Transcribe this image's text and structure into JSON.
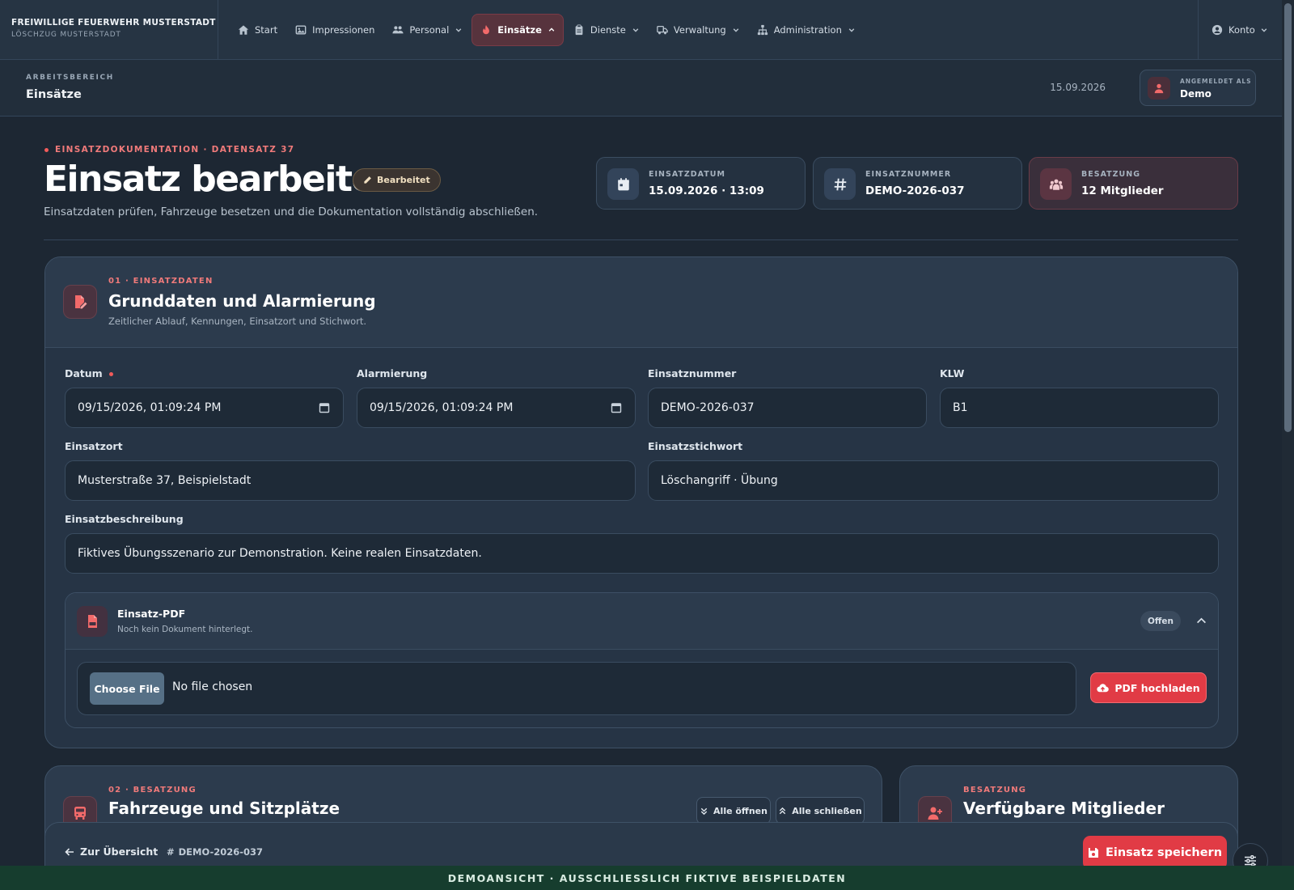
{
  "brand": {
    "name": "FREIWILLIGE FEUERWEHR MUSTERSTADT",
    "unit": "LÖSCHZUG MUSTERSTADT"
  },
  "nav": {
    "items": [
      {
        "label": "Start",
        "icon": "home-icon"
      },
      {
        "label": "Impressionen",
        "icon": "image-icon"
      },
      {
        "label": "Personal",
        "icon": "users-icon",
        "dropdown": true
      },
      {
        "label": "Einsätze",
        "icon": "flame-icon",
        "dropdown": true,
        "active": true
      },
      {
        "label": "Dienste",
        "icon": "clipboard-icon",
        "dropdown": true
      },
      {
        "label": "Verwaltung",
        "icon": "truck-icon",
        "dropdown": true
      },
      {
        "label": "Administration",
        "icon": "sitemap-icon",
        "dropdown": true
      }
    ],
    "account": {
      "label": "Konto",
      "icon": "user-circle-icon"
    }
  },
  "workspace": {
    "label": "ARBEITSBEREICH",
    "title": "Einsätze",
    "date": "15.09.2026",
    "user_label": "ANGEMELDET ALS",
    "user_name": "Demo"
  },
  "header": {
    "eyebrow": "EINSATZDOKUMENTATION · DATENSATZ 37",
    "title": "Einsatz bearbeiten",
    "badge": "Bearbeitet",
    "subtitle": "Einsatzdaten prüfen, Fahrzeuge besetzen und die Dokumentation vollständig abschließen.",
    "stats": [
      {
        "label": "EINSATZDATUM",
        "value": "15.09.2026 · 13:09",
        "icon": "calendar-icon"
      },
      {
        "label": "EINSATZNUMMER",
        "value": "DEMO-2026-037",
        "icon": "hash-icon"
      },
      {
        "label": "BESATZUNG",
        "value": "12 Mitglieder",
        "icon": "people-group-icon"
      }
    ]
  },
  "section1": {
    "eyebrow": "01 · EINSATZDATEN",
    "title": "Grunddaten und Alarmierung",
    "description": "Zeitlicher Ablauf, Kennungen, Einsatzort und Stichwort.",
    "fields": {
      "datum": {
        "label": "Datum",
        "value": "09/15/2026, 01:09:24 PM"
      },
      "alarmierung": {
        "label": "Alarmierung",
        "value": "09/15/2026, 01:09:24 PM"
      },
      "einsatznummer": {
        "label": "Einsatznummer",
        "value": "DEMO-2026-037"
      },
      "klw": {
        "label": "KLW",
        "value": "B1"
      },
      "einsatzort": {
        "label": "Einsatzort",
        "value": "Musterstraße 37, Beispielstadt"
      },
      "stichwort": {
        "label": "Einsatzstichwort",
        "value": "Löschangriff · Übung"
      },
      "beschreibung": {
        "label": "Einsatzbeschreibung",
        "value": "Fiktives Übungsszenario zur Demonstration. Keine realen Einsatzdaten."
      }
    },
    "pdf": {
      "title": "Einsatz-PDF",
      "subtitle": "Noch kein Dokument hinterlegt.",
      "status": "Offen",
      "choose_label": "Choose File",
      "no_file": "No file chosen",
      "upload_label": "PDF hochladen"
    }
  },
  "section2": {
    "eyebrow": "02 · BESATZUNG",
    "title": "Fahrzeuge und Sitzplätze",
    "open_all": "Alle öffnen",
    "close_all": "Alle schließen"
  },
  "section3": {
    "eyebrow": "BESATZUNG",
    "title": "Verfügbare Mitglieder"
  },
  "actionbar": {
    "back": "Zur Übersicht",
    "ref": "DEMO-2026-037",
    "save": "Einsatz speichern"
  },
  "footer": {
    "demo": "DEMOANSICHT · AUSSCHLIESSLICH FIKTIVE BEISPIELDATEN"
  },
  "colors": {
    "background": "#1d2733",
    "accent": "#e13b45",
    "accent_text": "#f07a7a",
    "demo_bar": "#163d2e"
  }
}
